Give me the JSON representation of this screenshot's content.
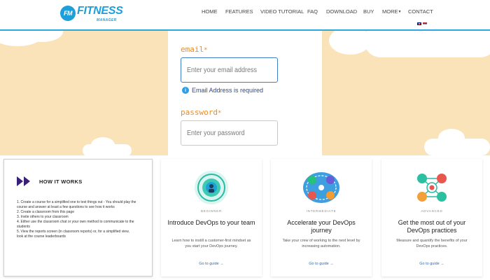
{
  "header": {
    "logo_badge": "FM",
    "logo_word": "FITNESS",
    "logo_sub": "MANAGER",
    "nav": {
      "home": "HOME",
      "features": "FEATURES",
      "video": "VIDEO TUTORIAL",
      "faq": "FAQ",
      "download": "DOWNLOAD",
      "buy": "BUY",
      "more": "MORE",
      "contact": "CONTACT"
    },
    "flags": [
      "flag-uk-icon",
      "flag-serbia-icon"
    ]
  },
  "login": {
    "email_label": "email",
    "email_placeholder": "Enter your email address",
    "email_error": "Email Address is required",
    "password_label": "password",
    "password_placeholder": "Enter your password",
    "required_mark": "*"
  },
  "how_it_works": {
    "title": "HOW IT WORKS",
    "steps": [
      "1. Create a course for a simplified one to test things out - You should play the",
      "   course and answer at least a few questions to see how it works",
      "2. Create a classroom from this page",
      "3. Invite others to your classroom",
      "4. Either use the classroom chat or your own method to communicate to the",
      "   students",
      "5. View the reports screen (in classroom reports) or, for a simplified view,",
      "   look at the course leaderboards"
    ]
  },
  "cards": [
    {
      "level": "BEGINNER",
      "title": "Introduce DevOps to your team",
      "desc": "Learn how to instill a customer-first mindset as you start your DevOps journey.",
      "link": "Go to guide →"
    },
    {
      "level": "INTERMEDIATE",
      "title": "Accelerate your DevOps journey",
      "desc": "Take your crew of working to the next level by increasing automation.",
      "link": "Go to guide →"
    },
    {
      "level": "ADVANCED",
      "title": "Get the most out of your DevOps practices",
      "desc": "Measure and quantify the benefits of your DevOps practices.",
      "link": "Go to guide →"
    }
  ],
  "colors": {
    "accent": "#1d9fd8",
    "band": "#fbe3b9",
    "label": "#e88c2b",
    "link": "#2a6db5"
  }
}
